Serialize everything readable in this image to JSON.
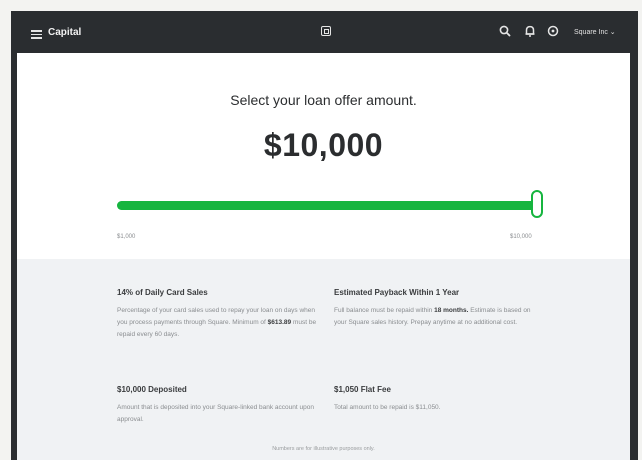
{
  "header": {
    "app_title": "Capital",
    "account_label": "Square Inc ⌄",
    "icons": [
      "menu-icon",
      "square-logo-icon",
      "search-icon",
      "bell-icon",
      "help-icon"
    ]
  },
  "offer": {
    "heading": "Select your loan offer amount.",
    "amount": "$10,000",
    "slider": {
      "min_label": "$1,000",
      "max_label": "$10,000",
      "value_fraction": 1.0
    }
  },
  "details": {
    "daily_sales": {
      "title": "14% of Daily Card Sales",
      "body_before": "Percentage of your card sales used to repay your loan on days when you process payments through Square. Minimum of ",
      "body_bold": "$613.89",
      "body_after": " must be repaid every 60 days."
    },
    "payback": {
      "title": "Estimated Payback Within 1 Year",
      "body_before": "Full balance must be repaid within ",
      "body_bold": "18 months.",
      "body_after": " Estimate is based on your Square sales history. Prepay anytime at no additional cost."
    },
    "deposit": {
      "title": "$10,000 Deposited",
      "body": "Amount that is deposited into your Square-linked bank account upon approval."
    },
    "fee": {
      "title": "$1,050 Flat Fee",
      "body": "Total amount to be repaid is $11,050."
    },
    "disclaimer": "Numbers are for illustrative purposes only."
  },
  "colors": {
    "topbar": "#2a2d30",
    "accent_green": "#16b53f",
    "panel_bg": "#f0f2f4"
  }
}
